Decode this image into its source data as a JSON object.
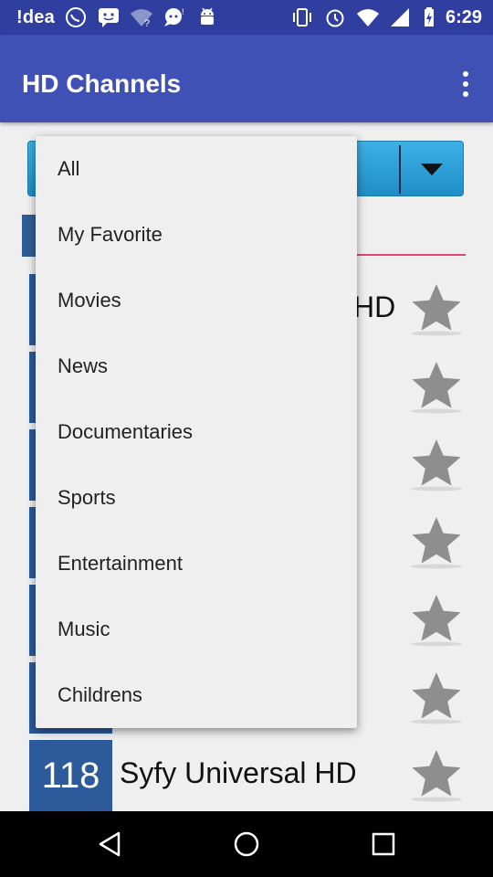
{
  "status_bar": {
    "carrier": "!dea",
    "time": "6:29",
    "icons": [
      "whatsapp-icon",
      "messenger-icon",
      "wifi-question-icon",
      "chat-icon",
      "android-icon",
      "vibrate-icon",
      "alarm-icon",
      "wifi-icon",
      "signal-icon",
      "battery-icon"
    ]
  },
  "app_bar": {
    "title": "HD Channels",
    "overflow_icon": "more-vert-icon"
  },
  "spinner": {
    "arrow_icon": "dropdown-arrow-icon",
    "color": "#29a0db"
  },
  "search": {
    "icon": "search-icon",
    "underline_color": "#e0447a"
  },
  "channels": [
    {
      "number": "",
      "name": "HD",
      "star_icon": "star-icon"
    },
    {
      "number": "",
      "name": "",
      "star_icon": "star-icon"
    },
    {
      "number": "",
      "name": "",
      "star_icon": "star-icon"
    },
    {
      "number": "",
      "name": "",
      "star_icon": "star-icon"
    },
    {
      "number": "",
      "name": "",
      "star_icon": "star-icon"
    },
    {
      "number": "",
      "name": "",
      "star_icon": "star-icon"
    },
    {
      "number": "118",
      "name": "Syfy Universal HD",
      "star_icon": "star-icon"
    }
  ],
  "menu": {
    "items": [
      "All",
      "My Favorite",
      "Movies",
      "News",
      "Documentaries",
      "Sports",
      "Entertainment",
      "Music",
      "Childrens"
    ]
  },
  "nav_bar": {
    "back_icon": "back-icon",
    "home_icon": "home-icon",
    "recents_icon": "recents-icon"
  },
  "colors": {
    "primary": "#3F51B5",
    "primary_dark": "#303F9F",
    "channel_badge": "#2c5a9a",
    "accent": "#e0447a"
  }
}
